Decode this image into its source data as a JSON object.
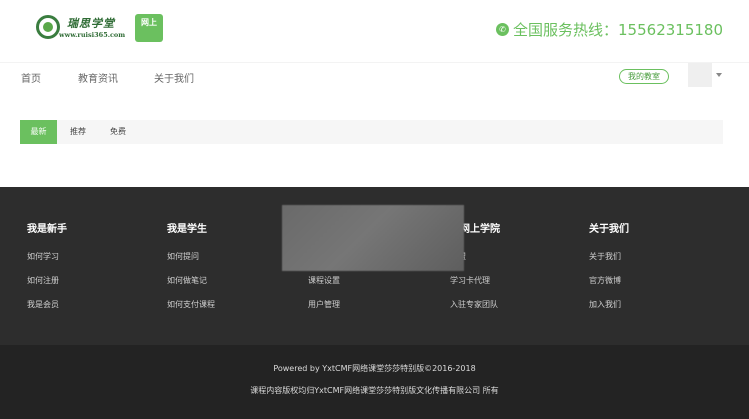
{
  "header": {
    "logo_title": "瑞思学堂",
    "logo_url": "www.ruisi365.com",
    "logo_badge": "网上",
    "hotline_label": "全国服务热线：",
    "hotline_number": "15562315180",
    "accent_color": "#6bc05f"
  },
  "nav": {
    "items": [
      {
        "label": "首页"
      },
      {
        "label": "教育资讯"
      },
      {
        "label": "关于我们"
      }
    ],
    "my_class_label": "我的教室"
  },
  "filter_tabs": [
    {
      "label": "最新",
      "active": true
    },
    {
      "label": "推荐",
      "active": false
    },
    {
      "label": "免费",
      "active": false
    }
  ],
  "footer": {
    "columns": [
      {
        "title": "我是新手",
        "links": [
          "如何学习",
          "如何注册",
          "我是会员"
        ]
      },
      {
        "title": "我是学生",
        "links": [
          "如何提问",
          "如何做笔记",
          "如何支付课程"
        ]
      },
      {
        "title": "",
        "links": [
          "",
          "课程设置",
          "用户管理"
        ]
      },
      {
        "title": "盟网上学院",
        "links": [
          "加盟",
          "学习卡代理",
          "入驻专家团队"
        ]
      },
      {
        "title": "关于我们",
        "links": [
          "关于我们",
          "官方微博",
          "加入我们"
        ]
      }
    ],
    "copyright_line1": "Powered by YxtCMF网络课堂莎莎特别版©2016-2018",
    "copyright_line2": "课程内容版权均归YxtCMF网络课堂莎莎特别版文化传播有限公司 所有"
  }
}
